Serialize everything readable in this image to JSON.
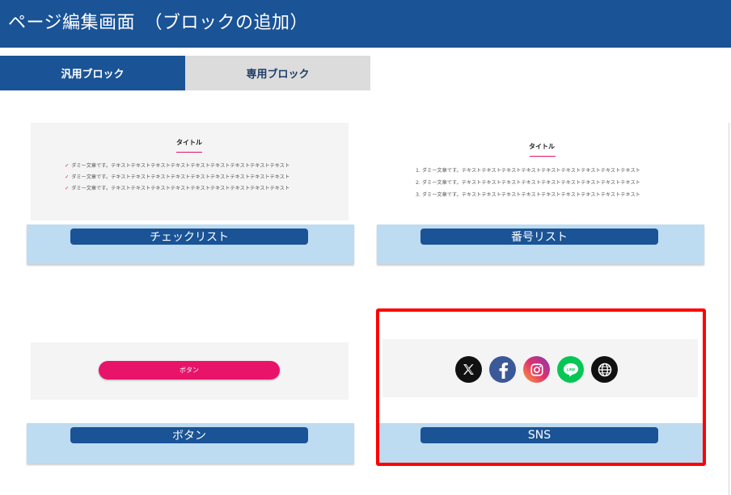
{
  "header": {
    "title": "ページ編集画面　（ブロックの追加）"
  },
  "tabs": [
    {
      "label": "汎用ブロック",
      "active": true
    },
    {
      "label": "専用ブロック",
      "active": false
    }
  ],
  "blocks": {
    "checklist": {
      "label": "チェックリスト",
      "preview_title": "タイトル",
      "lines": [
        "ダミー文章です。テキストテキストテキストテキストテキストテキストテキストテキストテキスト",
        "ダミー文章です。テキストテキストテキストテキストテキストテキストテキストテキストテキスト",
        "ダミー文章です。テキストテキストテキストテキストテキストテキストテキストテキストテキスト"
      ]
    },
    "numbered": {
      "label": "番号リスト",
      "preview_title": "タイトル",
      "lines": [
        "1. ダミー文章です。テキストテキストテキストテキストテキストテキストテキストテキストテキスト",
        "2. ダミー文章です。テキストテキストテキストテキストテキストテキストテキストテキストテキスト",
        "3. ダミー文章です。テキストテキストテキストテキストテキストテキストテキストテキストテキスト"
      ]
    },
    "button": {
      "label": "ボタン",
      "preview_button": "ボタン"
    },
    "sns": {
      "label": "SNS",
      "icons": [
        "x-icon",
        "facebook-icon",
        "instagram-icon",
        "line-icon",
        "web-icon"
      ],
      "colors": {
        "x": "#111111",
        "facebook": "#3b5998",
        "instagram": "#c13584",
        "line": "#06c755",
        "web": "#111111"
      }
    }
  },
  "colors": {
    "primary": "#1a5396",
    "accent": "#e8146a",
    "footer": "#bddcf1",
    "highlight": "#ff0000"
  }
}
